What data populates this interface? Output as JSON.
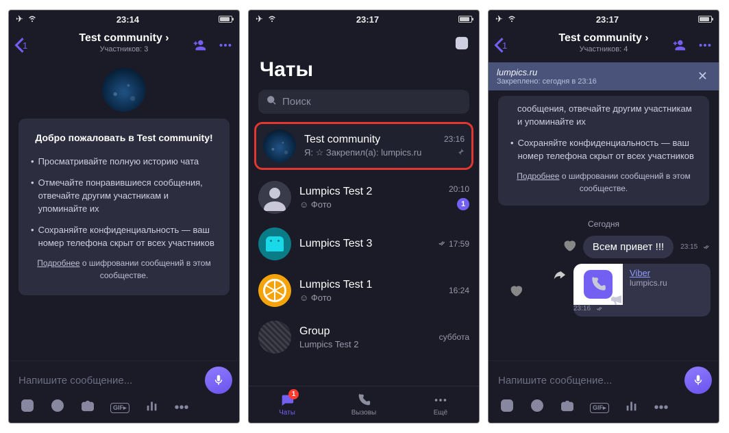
{
  "s1": {
    "status": {
      "time": "23:14"
    },
    "nav": {
      "backCount": "1",
      "title": "Test community ›",
      "subtitle": "Участников: 3"
    },
    "card": {
      "title": "Добро пожаловать в Test community!",
      "b1": "Просматривайте полную историю чата",
      "b2": "Отмечайте понравившиеся сообщения, отвечайте другим участникам и упоминайте их",
      "b3": "Сохраняйте конфиденциальность — ваш номер телефона скрыт от всех участников",
      "moreLink": "Подробнее",
      "moreRest": " о шифровании сообщений в этом сообществе."
    },
    "composer": {
      "placeholder": "Напишите сообщение..."
    }
  },
  "s2": {
    "status": {
      "time": "23:17"
    },
    "title": "Чаты",
    "searchPlaceholder": "Поиск",
    "items": {
      "i0": {
        "name": "Test community",
        "sub": "Я: ☆ Закрепил(а): lumpics.ru",
        "time": "23:16"
      },
      "i1": {
        "name": "Lumpics Test 2",
        "sub": "☺ Фото",
        "time": "20:10",
        "badge": "1"
      },
      "i2": {
        "name": "Lumpics Test 3",
        "time": "17:59"
      },
      "i3": {
        "name": "Lumpics Test 1",
        "sub": "☺ Фото",
        "time": "16:24"
      },
      "i4": {
        "name": "Group",
        "sub": "Lumpics Test 2",
        "time": "суббота"
      }
    },
    "tabs": {
      "chats": "Чаты",
      "chatsBadge": "1",
      "calls": "Вызовы",
      "more": "Ещё"
    }
  },
  "s3": {
    "status": {
      "time": "23:17"
    },
    "nav": {
      "backCount": "1",
      "title": "Test community ›",
      "subtitle": "Участников: 4"
    },
    "pinned": {
      "title": "lumpics.ru",
      "sub": "Закреплено: сегодня в 23:16"
    },
    "card": {
      "b2": "сообщения, отвечайте другим участникам и упоминайте их",
      "b3": "Сохраняйте конфиденциальность — ваш номер телефона скрыт от всех участников",
      "moreLink": "Подробнее",
      "moreRest": " о шифровании сообщений в этом сообществе."
    },
    "dateSep": "Сегодня",
    "msg1": {
      "text": "Всем привет !!!",
      "time": "23:15"
    },
    "link": {
      "title": "Viber",
      "domain": "lumpics.ru",
      "time": "23:16"
    },
    "composer": {
      "placeholder": "Напишите сообщение..."
    }
  }
}
